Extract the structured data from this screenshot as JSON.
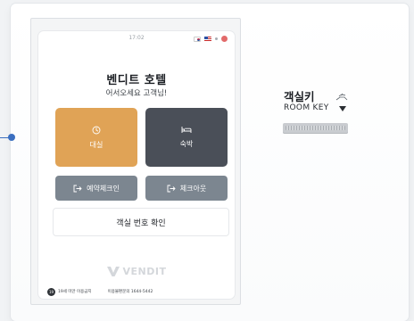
{
  "status_bar": {
    "time": "17:02"
  },
  "screen": {
    "hotel_name": "벤디트 호텔",
    "welcome": "어서오세요 고객님!",
    "tiles": {
      "rent_label": "대실",
      "stay_label": "숙박"
    },
    "buttons": {
      "checkin_label": "예약체크인",
      "checkout_label": "체크아웃"
    },
    "room_check_label": "객실 번호 확인",
    "logo_text": "VENDIT",
    "footer": {
      "age_badge": "19",
      "age_notice": "19세 미만 이용금지",
      "phone_notice": "이용불편문의 1644-5442"
    }
  },
  "room_key": {
    "label_ko": "객실키",
    "label_en": "ROOM KEY"
  },
  "colors": {
    "rent_tile": "#e0a356",
    "stay_tile": "#4a4f58",
    "gray_button": "#7c8690",
    "indicator": "#3b6fc0"
  }
}
